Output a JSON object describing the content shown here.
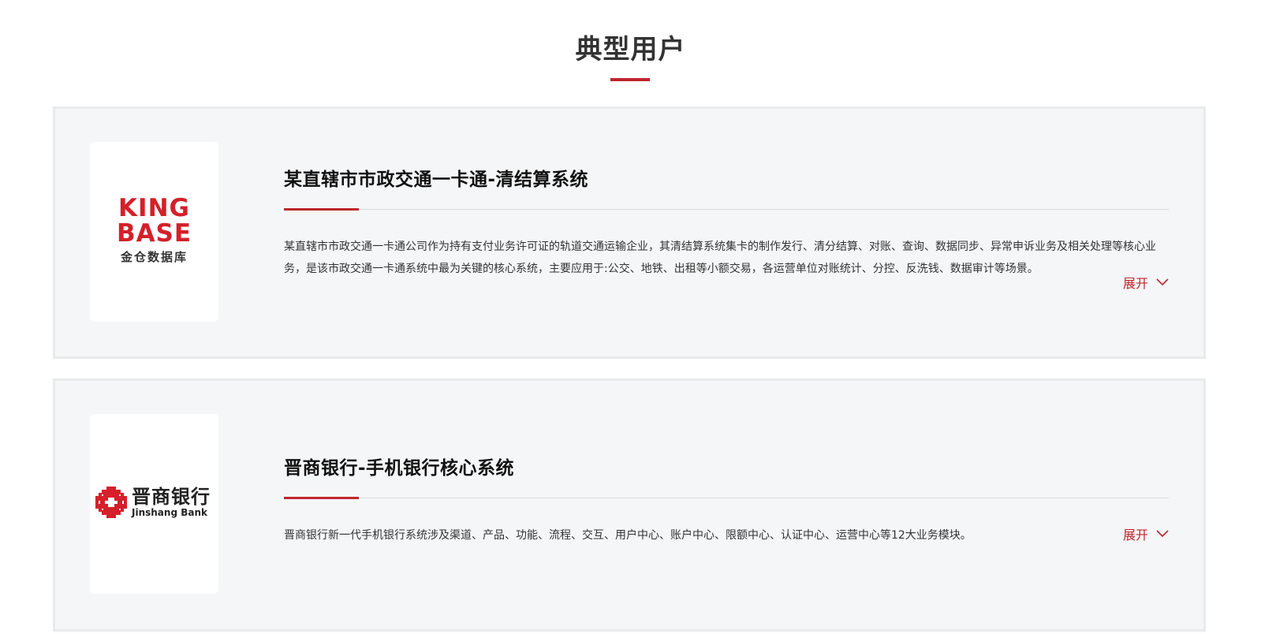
{
  "section": {
    "title": "典型用户"
  },
  "cases": [
    {
      "logo": {
        "line1": "KING",
        "line2": "BASE",
        "cn": "金仓数据库"
      },
      "title": "某直辖市市政交通一卡通-清结算系统",
      "desc": "某直辖市市政交通一卡通公司作为持有支付业务许可证的轨道交通运输企业，其清结算系统集卡的制作发行、清分结算、对账、查询、数据同步、异常申诉业务及相关处理等核心业务，是该市政交通一卡通系统中最为关键的核心系统，主要应用于:公交、地铁、出租等小额交易，各运营单位对账统计、分控、反洗钱、数据审计等场景。",
      "expand_label": "展开"
    },
    {
      "logo": {
        "cn": "晋商银行",
        "en": "Jinshang Bank"
      },
      "title": "晋商银行-手机银行核心系统",
      "desc": "晋商银行新一代手机银行系统涉及渠道、产品、功能、流程、交互、用户中心、账户中心、限额中心、认证中心、运营中心等12大业务模块。",
      "expand_label": "展开"
    }
  ],
  "colors": {
    "accent": "#c0262d",
    "card_bg": "#f5f6f8",
    "card_border": "#e9eaec"
  },
  "icons": {
    "expand": "chevron-down-icon"
  }
}
